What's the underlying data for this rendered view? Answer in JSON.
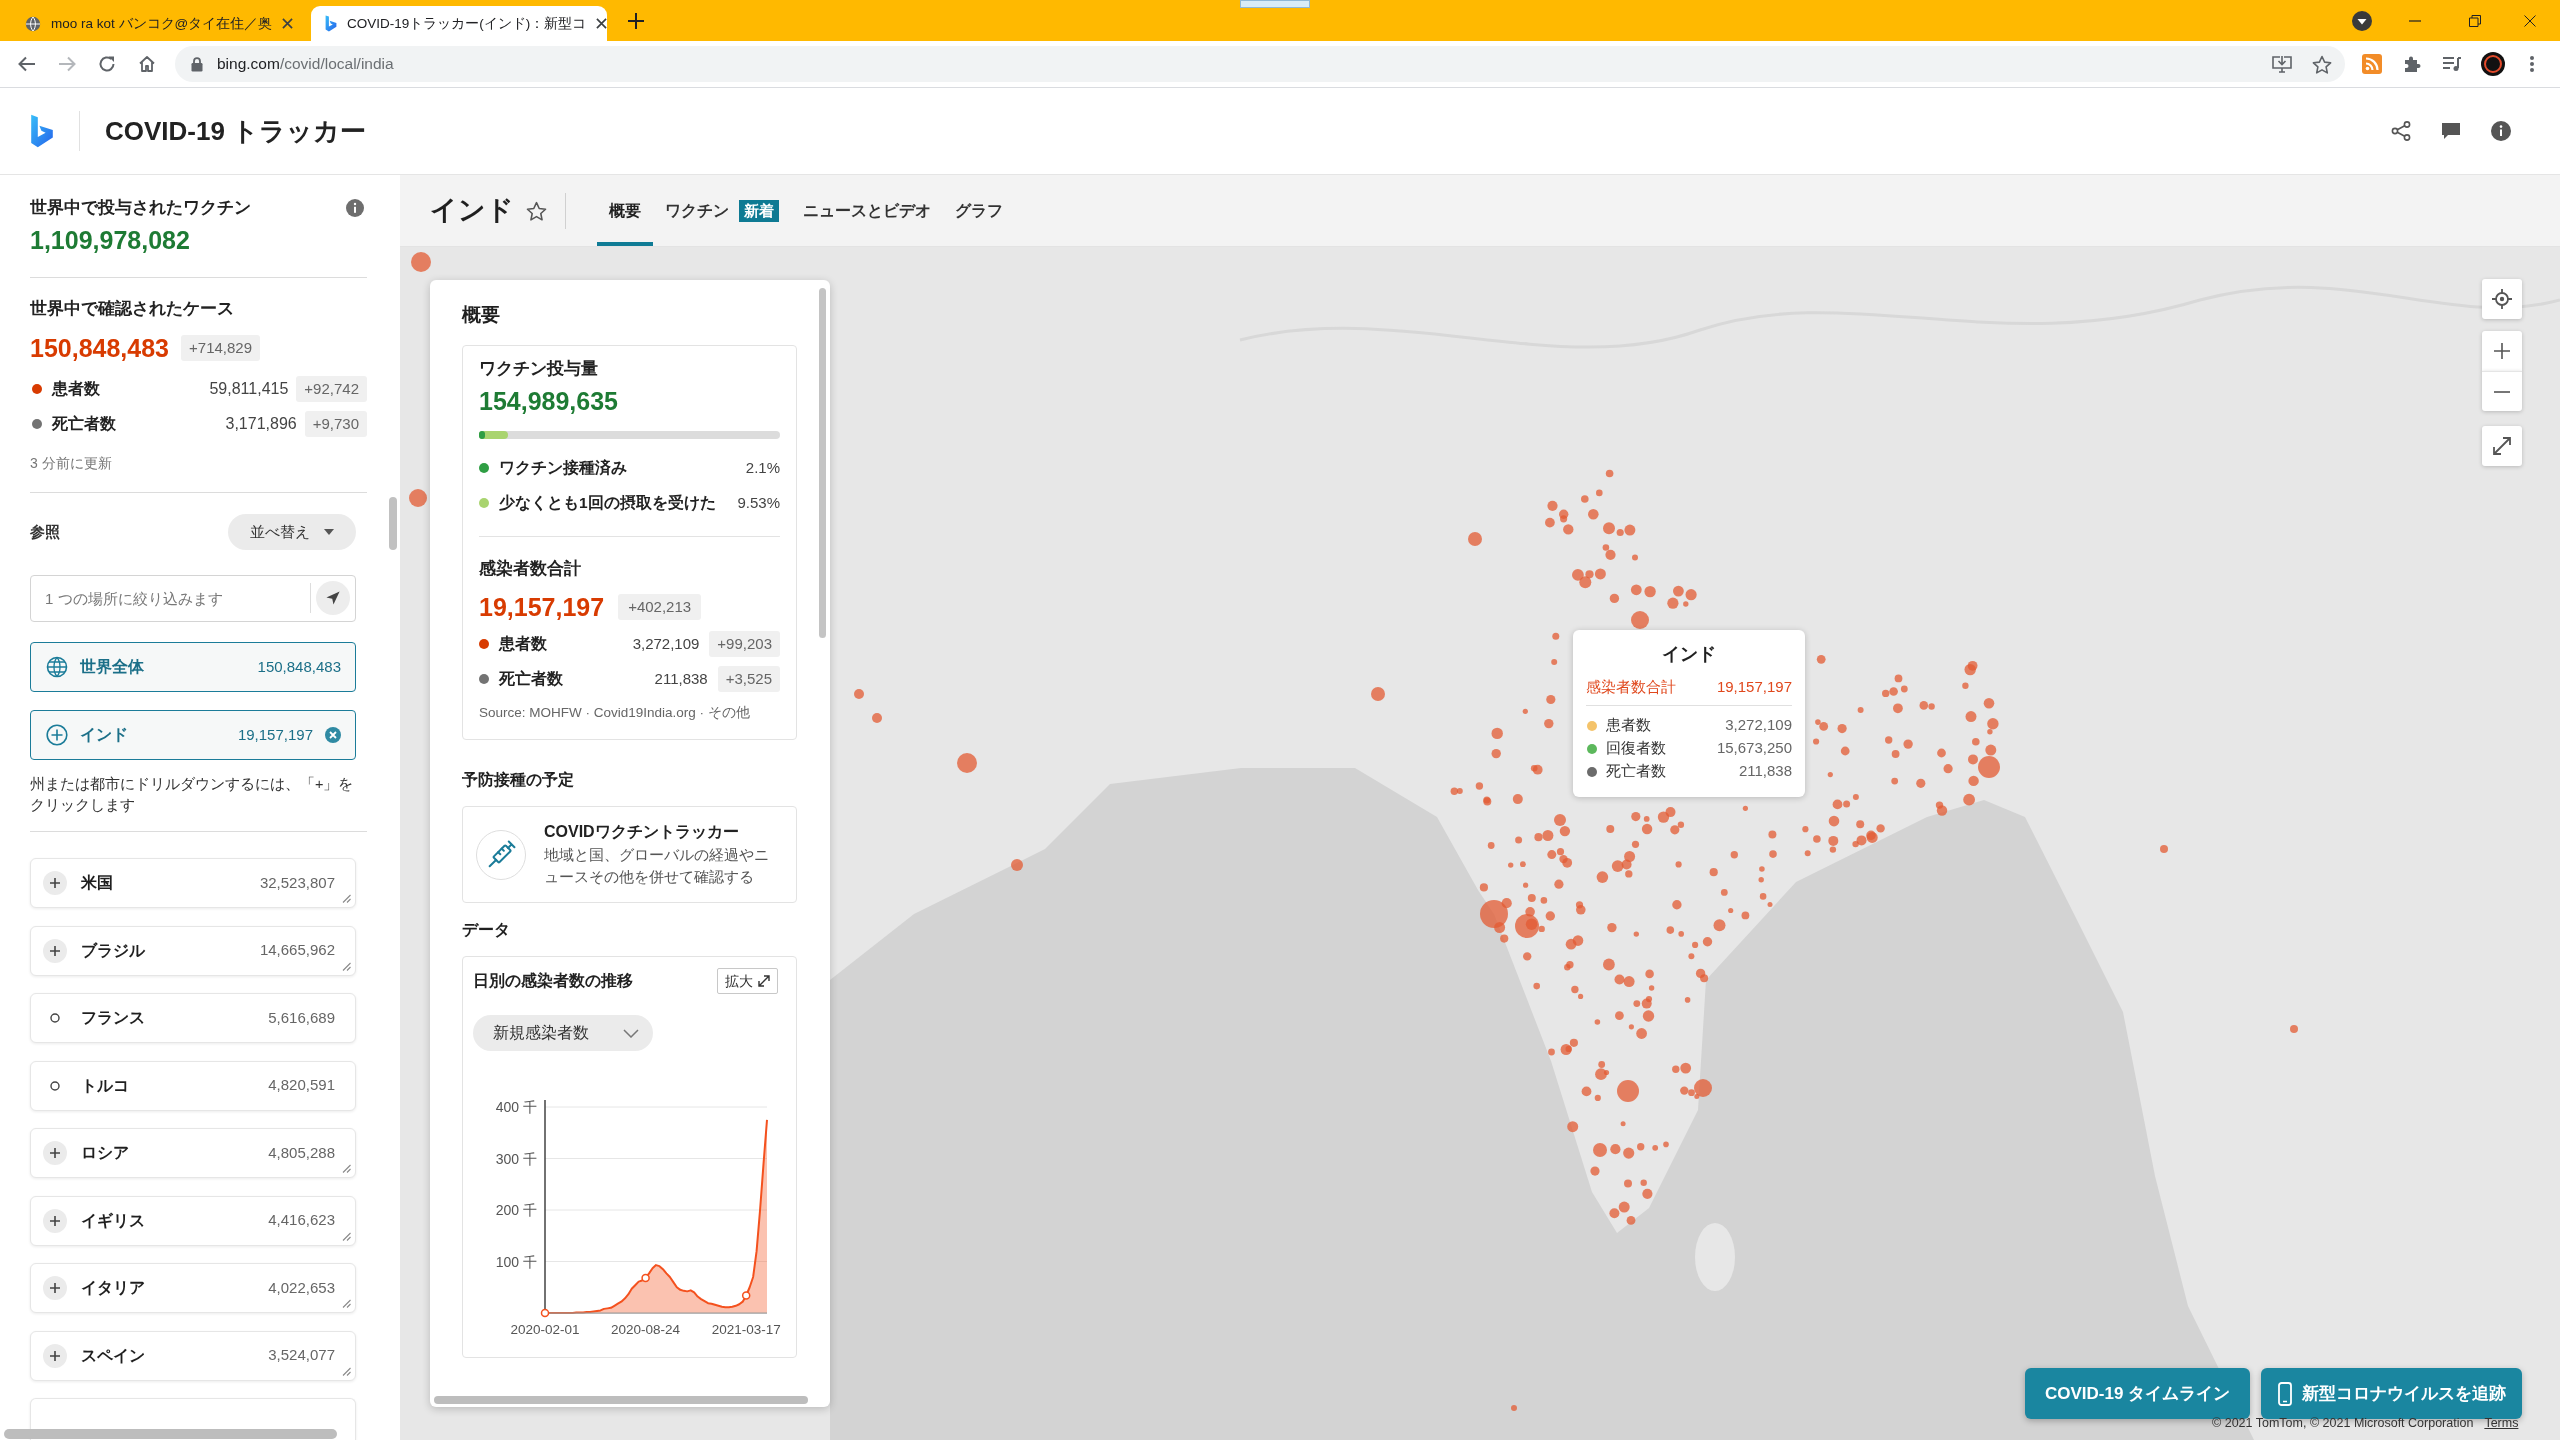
{
  "browser": {
    "tabs": [
      {
        "kind": "globe",
        "title": "moo ra kot バンコク@タイ在住／奥",
        "selected": false
      },
      {
        "kind": "logo",
        "title": "COVID-19トラッカー(インド)：新型コ",
        "selected": true
      }
    ],
    "address": {
      "host": "bing.com",
      "path": "/covid/local/india"
    }
  },
  "header": {
    "title": "COVID-19 トラッカー"
  },
  "sidebar": {
    "vaccines": {
      "label": "世界中で投与されたワクチン",
      "value": "1,109,978,082"
    },
    "cases": {
      "label": "世界中で確認されたケース",
      "value": "150,848,483",
      "change": "+714,829",
      "rows": [
        {
          "label": "患者数",
          "value": "59,811,415",
          "change": "+92,742",
          "color": "#d83b01"
        },
        {
          "label": "死亡者数",
          "value": "3,171,896",
          "change": "+9,730",
          "color": "#737373"
        }
      ]
    },
    "updated": "3 分前に更新",
    "browse": {
      "label": "参照",
      "sort": "並べ替え"
    },
    "search": {
      "placeholder": "1 つの場所に絞り込みます"
    },
    "scopes": [
      {
        "kind": "world",
        "label": "世界全体",
        "value": "150,848,483"
      },
      {
        "kind": "country",
        "label": "インド",
        "value": "19,157,197"
      }
    ],
    "hint": "州または都市にドリルダウンするには、「+」をクリックします",
    "countries": [
      {
        "name": "米国",
        "value": "32,523,807",
        "expandable": true
      },
      {
        "name": "ブラジル",
        "value": "14,665,962",
        "expandable": true
      },
      {
        "name": "フランス",
        "value": "5,616,689",
        "expandable": false
      },
      {
        "name": "トルコ",
        "value": "4,820,591",
        "expandable": false
      },
      {
        "name": "ロシア",
        "value": "4,805,288",
        "expandable": true
      },
      {
        "name": "イギリス",
        "value": "4,416,623",
        "expandable": true
      },
      {
        "name": "イタリア",
        "value": "4,022,653",
        "expandable": true
      },
      {
        "name": "スペイン",
        "value": "3,524,077",
        "expandable": true
      }
    ]
  },
  "location": {
    "title": "インド",
    "tabs": [
      {
        "label": "概要",
        "selected": true
      },
      {
        "label": "ワクチン",
        "badge": "新着",
        "selected": false
      },
      {
        "label": "ニュースとビデオ",
        "selected": false
      },
      {
        "label": "グラフ",
        "selected": false
      }
    ]
  },
  "overview": {
    "title": "概要",
    "vaccine": {
      "label": "ワクチン投与量",
      "value": "154,989,635",
      "shares": [
        {
          "label": "ワクチン接種済み",
          "value": "2.1%",
          "level": 0.021,
          "color": "#2f9e44"
        },
        {
          "label": "少なくとも1回の摂取を受けた",
          "value": "9.53%",
          "level": 0.0953,
          "color": "#a9d46f"
        }
      ]
    },
    "cases": {
      "label": "感染者数合計",
      "value": "19,157,197",
      "change": "+402,213",
      "rows": [
        {
          "label": "患者数",
          "value": "3,272,109",
          "change": "+99,203",
          "color": "#d83b01"
        },
        {
          "label": "死亡者数",
          "value": "211,838",
          "change": "+3,525",
          "color": "#737373"
        }
      ],
      "source": {
        "prefix": "Source:",
        "separator": "·",
        "links": [
          "MOHFW",
          "Covid19India.org",
          "その他"
        ]
      }
    },
    "schedule": {
      "title": "予防接種の予定",
      "card": {
        "title": "COVIDワクチントラッカー",
        "text": "地域と国、グローバルの経過やニュースその他を併せて確認する"
      }
    },
    "data": {
      "title": "データ",
      "chart": {
        "title": "日別の感染者数の推移",
        "expand": "拡大",
        "metric": "新規感染者数",
        "chart_data": {
          "type": "area",
          "categories": [
            "2020-02-01",
            null,
            null,
            null,
            null,
            null,
            null,
            null,
            null,
            null,
            null,
            null,
            null,
            null,
            null,
            null,
            null,
            null,
            null,
            null,
            null,
            null,
            null,
            null,
            null,
            null,
            null,
            null,
            null,
            "2020-08-24",
            null,
            null,
            null,
            null,
            null,
            null,
            null,
            null,
            null,
            null,
            null,
            null,
            null,
            null,
            null,
            null,
            null,
            null,
            null,
            null,
            null,
            null,
            null,
            null,
            null,
            null,
            null,
            null,
            "2021-03-17",
            null,
            null,
            null,
            null,
            null,
            null
          ],
          "series": [
            {
              "color": "#f4511e",
              "values": [
                0,
                0,
                0,
                0,
                0,
                0,
                0,
                0,
                0,
                1,
                1,
                1,
                2,
                2,
                3,
                4,
                5,
                8,
                9,
                10,
                14,
                18,
                22,
                28,
                36,
                47,
                54,
                61,
                63,
                68,
                77,
                87,
                93,
                91,
                85,
                77,
                70,
                60,
                50,
                45,
                43,
                42,
                44,
                40,
                32,
                27,
                23,
                19,
                18,
                16,
                14,
                12,
                11,
                11,
                12,
                14,
                17,
                22,
                34,
                50,
                70,
                120,
                200,
                290,
                375
              ]
            }
          ],
          "ylim": [
            0,
            400
          ],
          "yticks": [
            {
              "value": 100,
              "label": "100 千"
            },
            {
              "value": 200,
              "label": "200 千"
            },
            {
              "value": 300,
              "label": "300 千"
            },
            {
              "value": 400,
              "label": "400 千"
            }
          ],
          "grid": true
        }
      }
    }
  },
  "tooltip": {
    "title": "インド",
    "total": {
      "label": "感染者数合計",
      "value": "19,157,197"
    },
    "rows": [
      {
        "label": "患者数",
        "value": "3,272,109",
        "color": "#f4c36a"
      },
      {
        "label": "回復者数",
        "value": "15,673,250",
        "color": "#5cb85c"
      },
      {
        "label": "死亡者数",
        "value": "211,838",
        "color": "#6b6b6b"
      }
    ]
  },
  "actions": [
    {
      "kind": "plain",
      "label": "COVID-19 タイムライン"
    },
    {
      "kind": "phone",
      "label": "新型コロナウイルスを追跡"
    }
  ],
  "attribution": {
    "text": "© 2021 TomTom, © 2021 Microsoft Corporation",
    "link": "Terms"
  }
}
